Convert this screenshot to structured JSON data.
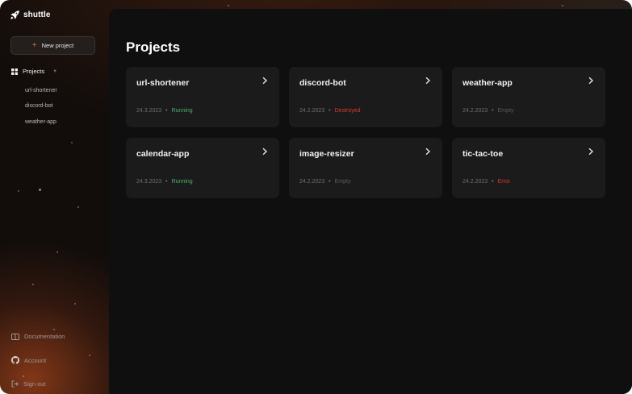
{
  "app": {
    "name": "shuttle"
  },
  "sidebar": {
    "new_project_label": "New project",
    "projects_label": "Projects",
    "project_items": [
      "url-shortener",
      "discord-bot",
      "weather-app"
    ],
    "documentation_label": "Documentation",
    "account_label": "Account",
    "sign_out_label": "Sign out"
  },
  "main": {
    "title": "Projects",
    "projects": [
      {
        "name": "url-shortener",
        "date": "24.3.2023",
        "status": "Running"
      },
      {
        "name": "discord-bot",
        "date": "24.2.2023",
        "status": "Destroyed"
      },
      {
        "name": "weather-app",
        "date": "24.2.2023",
        "status": "Empty"
      },
      {
        "name": "calendar-app",
        "date": "24.3.2023",
        "status": "Running"
      },
      {
        "name": "image-resizer",
        "date": "24.2.2023",
        "status": "Empty"
      },
      {
        "name": "tic-tac-toe",
        "date": "24.2.2023",
        "status": "Error"
      }
    ]
  },
  "colors": {
    "accent": "#e06a3a",
    "status_running": "#4fae6b",
    "status_destroyed": "#d9392e",
    "status_error": "#d9392e",
    "status_empty": "#5b5b5b"
  },
  "icons": {
    "logo": "rocket-icon",
    "new_project": "plus-icon",
    "projects": "grid-icon",
    "documentation": "book-icon",
    "account": "github-icon",
    "sign_out": "sign-out-icon",
    "card": "chevron-right-icon"
  }
}
